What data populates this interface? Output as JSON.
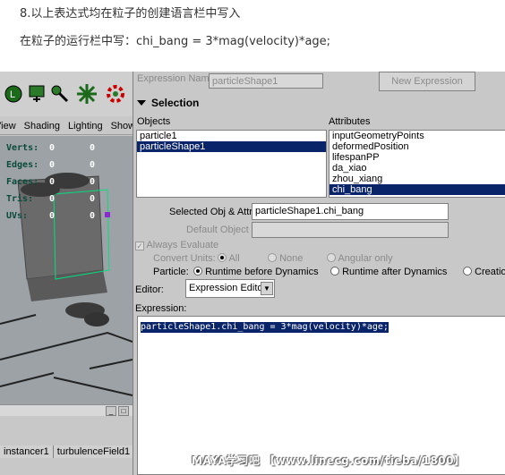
{
  "article": {
    "line1": "8.以上表达式均在粒子的创建语言栏中写入",
    "line2": "在粒子的运行栏中写：chi_bang = 3*mag(velocity)*age;"
  },
  "shelf": {
    "icons": [
      "L",
      "IK",
      "sculpt",
      "star",
      "gear"
    ]
  },
  "viewport_menu": [
    "View",
    "Shading",
    "Lighting",
    "Show"
  ],
  "hud": [
    {
      "label": "Verts:",
      "a": "0",
      "b": "0"
    },
    {
      "label": "Edges:",
      "a": "0",
      "b": "0"
    },
    {
      "label": "Faces:",
      "a": "0",
      "b": "0"
    },
    {
      "label": "Tris:",
      "a": "0",
      "b": "0"
    },
    {
      "label": "UVs:",
      "a": "0",
      "b": "0"
    }
  ],
  "bottom_tabs": [
    "instancer1",
    "turbulenceField1"
  ],
  "editor": {
    "expression_name_label": "Expression Name",
    "expression_name_value": "particleShape1",
    "new_expression": "New Expression",
    "selection_header": "Selection",
    "objects_header": "Objects",
    "attributes_header": "Attributes",
    "objects": [
      {
        "name": "particle1",
        "selected": false
      },
      {
        "name": "particleShape1",
        "selected": true
      }
    ],
    "attributes": [
      {
        "name": "inputGeometryPoints",
        "selected": false
      },
      {
        "name": "deformedPosition",
        "selected": false
      },
      {
        "name": "lifespanPP",
        "selected": false
      },
      {
        "name": "da_xiao",
        "selected": false
      },
      {
        "name": "zhou_xiang",
        "selected": false
      },
      {
        "name": "chi_bang",
        "selected": true
      }
    ],
    "selected_obj_attr_label": "Selected Obj & Attr",
    "selected_obj_attr_value": "particleShape1.chi_bang",
    "default_object_label": "Default Object",
    "default_object_value": "",
    "always_evaluate": "Always Evaluate",
    "convert_units_label": "Convert Units:",
    "convert_units_options": [
      "All",
      "None",
      "Angular only"
    ],
    "particle_label": "Particle:",
    "particle_options": [
      "Runtime before Dynamics",
      "Runtime after Dynamics",
      "Creation"
    ],
    "editor_label": "Editor:",
    "editor_value": "Expression Editor",
    "expression_label": "Expression:",
    "expression_text": "particleShape1.chi_bang = 3*mag(velocity)*age;"
  },
  "watermark": "MAYA学习吧 【www.linecg.com/tieba/1800】"
}
